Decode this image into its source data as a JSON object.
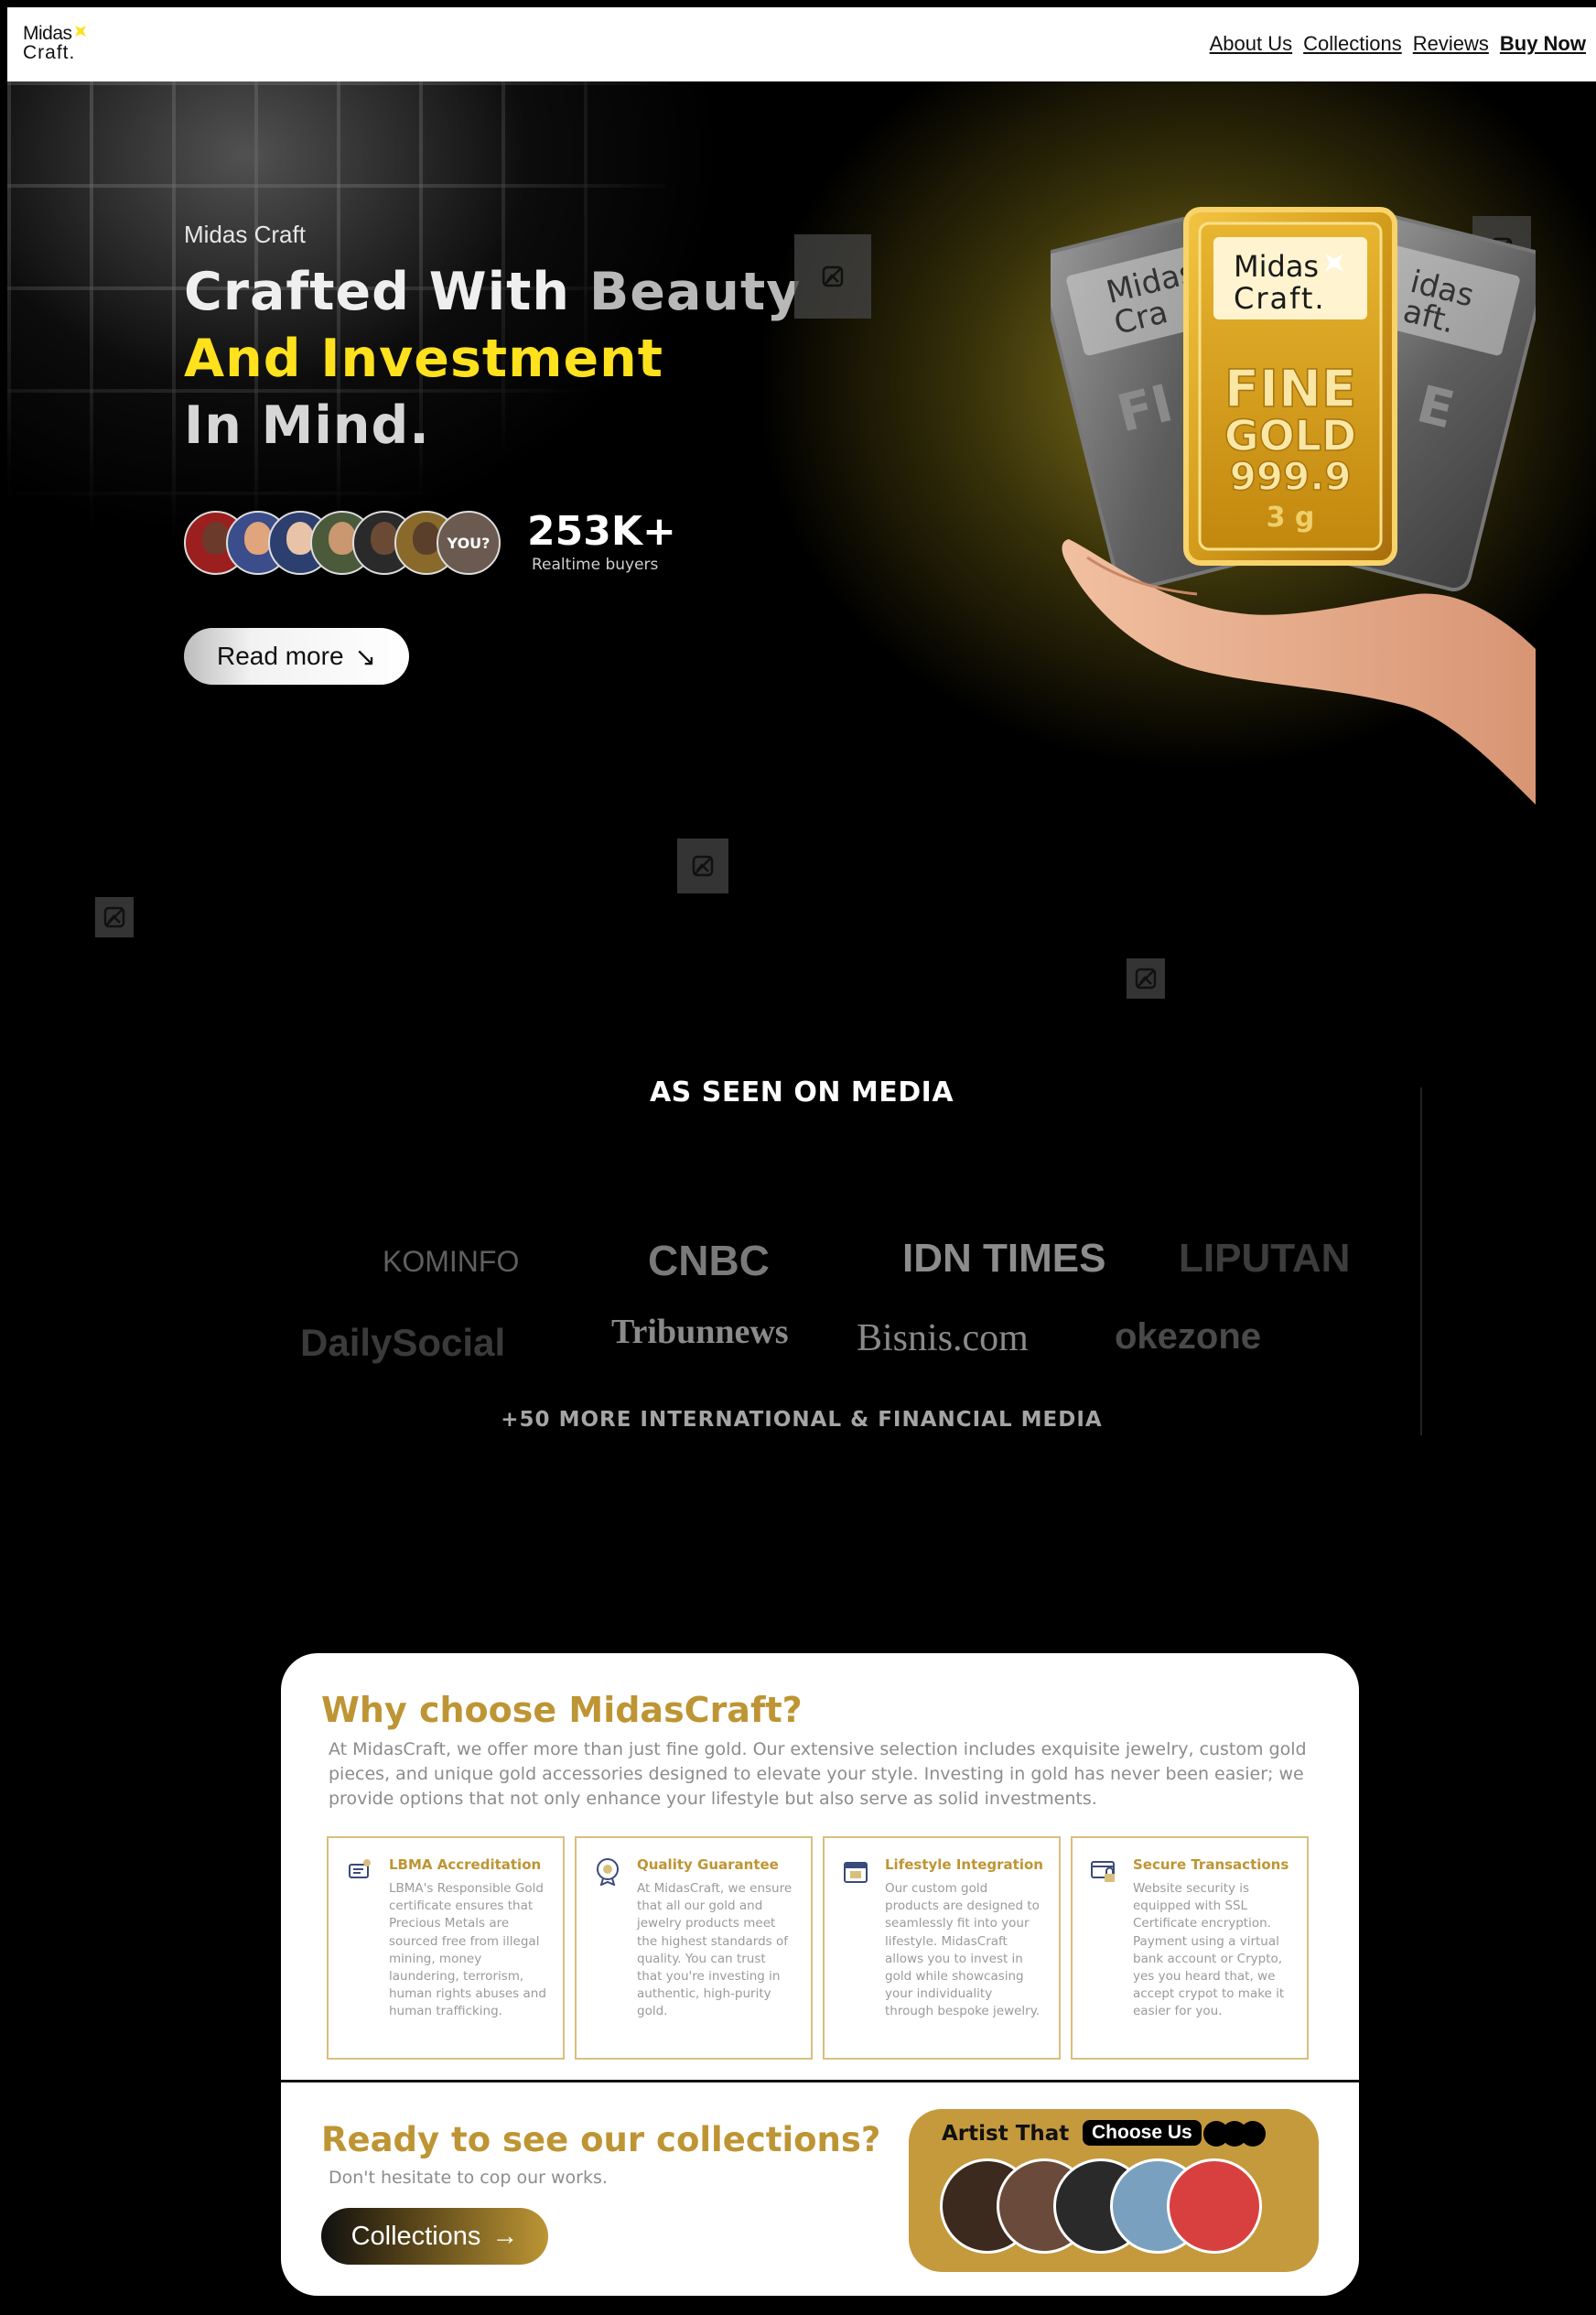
{
  "header": {
    "logo_line1": "Midas",
    "logo_line2": "Craft.",
    "nav": [
      "About Us",
      "Collections",
      "Reviews",
      "Buy Now"
    ]
  },
  "hero": {
    "eyebrow": "Midas Craft",
    "headline_line1_a": "Crafted With",
    "headline_line1_b": "Beauty",
    "headline_line2": "And Investment",
    "headline_line3": "In Mind.",
    "avatar_you": "YOU?",
    "stat_value": "253K+",
    "stat_label": "Realtime buyers",
    "cta_label": "Read more",
    "cta_arrow": "↘",
    "bar_brand_line1": "Midas",
    "bar_brand_line2": "Craft.",
    "bar_text_line1": "FINE",
    "bar_text_line2": "GOLD",
    "bar_text_line3": "999.9",
    "bar_text_line4": "3 g",
    "colors": {
      "accent_yellow": "#ffe11d",
      "gold": "#be9534"
    }
  },
  "media": {
    "title": "AS SEEN ON MEDIA",
    "logos": [
      "KOMINFO",
      "CNBC",
      "IDN TIMES",
      "LIPUTAN",
      "DailySocial",
      "Tribunnews",
      "Bisnis.com",
      "okezone"
    ],
    "more": "+50 MORE INTERNATIONAL & FINANCIAL MEDIA"
  },
  "why": {
    "title": "Why choose MidasCraft?",
    "description": "At MidasCraft, we offer more than just fine gold. Our extensive selection includes exquisite jewelry, custom gold pieces, and unique gold accessories designed to elevate your style. Investing in gold has never been easier; we provide options that not only enhance your lifestyle but also serve as solid investments.",
    "features": [
      {
        "icon": "certificate-icon",
        "title": "LBMA Accreditation",
        "text": "LBMA's Responsible Gold certificate ensures that Precious Metals are sourced free from illegal mining, money laundering, terrorism, human rights abuses and human trafficking."
      },
      {
        "icon": "quality-badge-icon",
        "title": "Quality Guarantee",
        "text": "At MidasCraft, we ensure that all our gold and jewelry products meet the highest standards of quality. You can trust that you're investing in authentic, high-purity gold."
      },
      {
        "icon": "calendar-icon",
        "title": "Lifestyle Integration",
        "text": "Our custom gold products are designed to seamlessly fit into your lifestyle. MidasCraft allows you to invest in gold while showcasing your individuality through bespoke jewelry."
      },
      {
        "icon": "secure-card-icon",
        "title": "Secure Transactions",
        "text": "Website security is equipped with SSL Certificate encryption. Payment using a virtual bank account or Crypto, yes you heard that, we accept crypot to make it easier for you."
      }
    ]
  },
  "ready": {
    "title": "Ready to see our collections?",
    "subtitle": "Don't hesitate to cop our works.",
    "button_label": "Collections",
    "button_arrow": "→",
    "artist_title": "Artist That",
    "artist_pill": "Choose Us"
  }
}
